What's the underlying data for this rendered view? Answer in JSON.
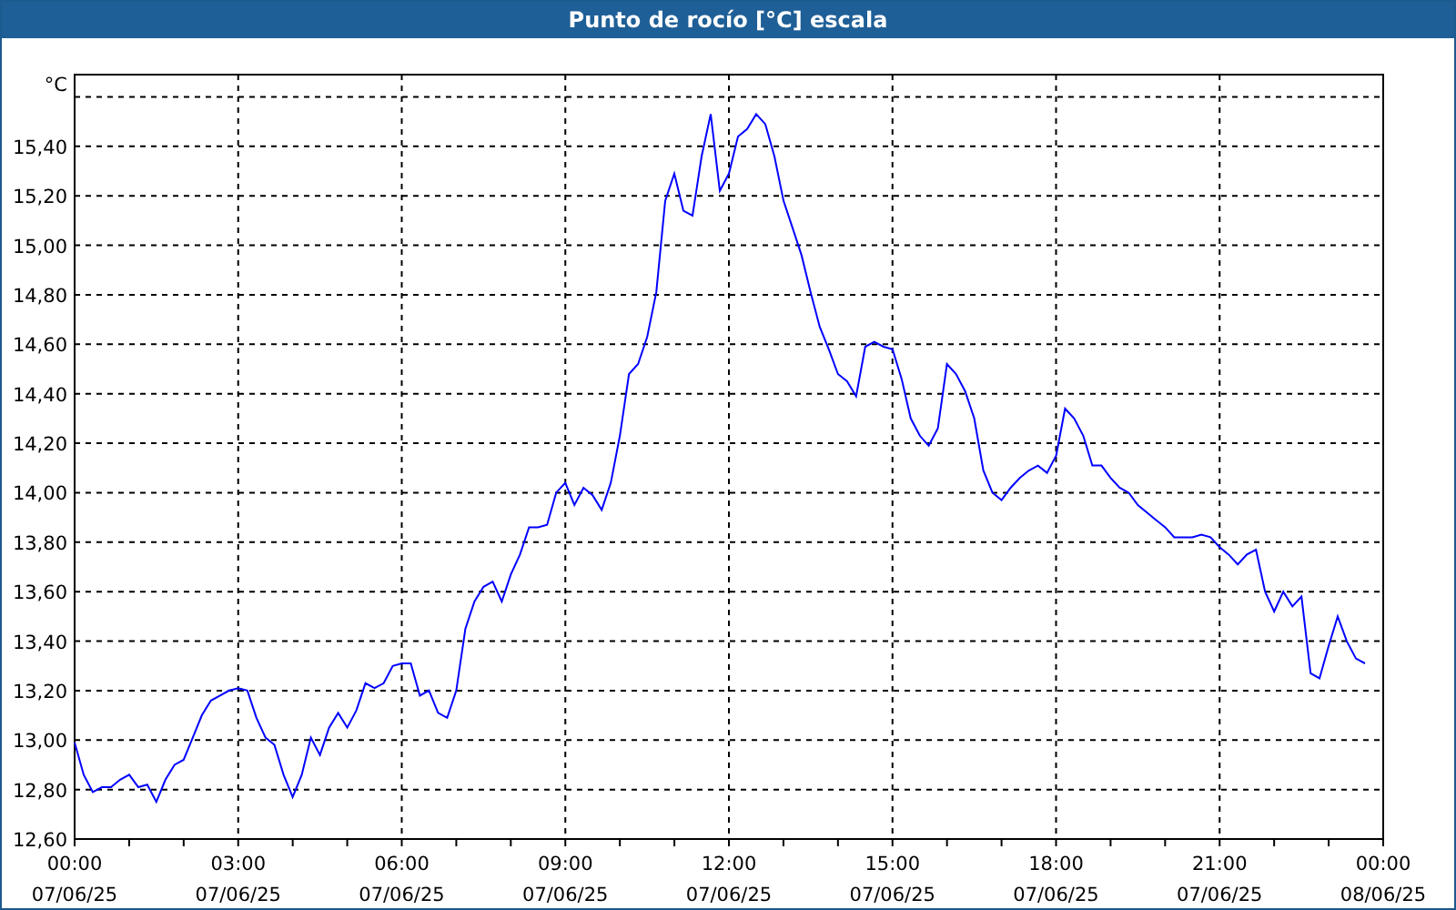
{
  "window": {
    "title": "Punto de rocío [°C] escala"
  },
  "chart": {
    "chart_data": {
      "type": "line",
      "grid": true,
      "ylabel": "°C",
      "ylim": [
        12.6,
        15.69
      ],
      "yticks": [
        {
          "value": 12.6,
          "label": "12,60"
        },
        {
          "value": 12.8,
          "label": "12,80"
        },
        {
          "value": 13.0,
          "label": "13,00"
        },
        {
          "value": 13.2,
          "label": "13,20"
        },
        {
          "value": 13.4,
          "label": "13,40"
        },
        {
          "value": 13.6,
          "label": "13,60"
        },
        {
          "value": 13.8,
          "label": "13,80"
        },
        {
          "value": 14.0,
          "label": "14,00"
        },
        {
          "value": 14.2,
          "label": "14,20"
        },
        {
          "value": 14.4,
          "label": "14,40"
        },
        {
          "value": 14.6,
          "label": "14,60"
        },
        {
          "value": 14.8,
          "label": "14,80"
        },
        {
          "value": 15.0,
          "label": "15,00"
        },
        {
          "value": 15.2,
          "label": "15,20"
        },
        {
          "value": 15.4,
          "label": "15,40"
        }
      ],
      "categories": [
        "00:00\n07/06/25",
        null,
        null,
        null,
        null,
        null,
        null,
        null,
        null,
        null,
        null,
        null,
        null,
        null,
        null,
        null,
        null,
        null,
        "03:00\n07/06/25",
        null,
        null,
        null,
        null,
        null,
        null,
        null,
        null,
        null,
        null,
        null,
        null,
        null,
        null,
        null,
        null,
        null,
        "06:00\n07/06/25",
        null,
        null,
        null,
        null,
        null,
        null,
        null,
        null,
        null,
        null,
        null,
        null,
        null,
        null,
        null,
        null,
        null,
        "09:00\n07/06/25",
        null,
        null,
        null,
        null,
        null,
        null,
        null,
        null,
        null,
        null,
        null,
        null,
        null,
        null,
        null,
        null,
        null,
        "12:00\n07/06/25",
        null,
        null,
        null,
        null,
        null,
        null,
        null,
        null,
        null,
        null,
        null,
        null,
        null,
        null,
        null,
        null,
        null,
        "15:00\n07/06/25",
        null,
        null,
        null,
        null,
        null,
        null,
        null,
        null,
        null,
        null,
        null,
        null,
        null,
        null,
        null,
        null,
        null,
        "18:00\n07/06/25",
        null,
        null,
        null,
        null,
        null,
        null,
        null,
        null,
        null,
        null,
        null,
        null,
        null,
        null,
        null,
        null,
        null,
        "21:00\n07/06/25",
        null,
        null,
        null,
        null,
        null,
        null,
        null,
        null,
        null,
        null,
        null,
        null,
        null,
        null,
        null,
        null,
        null,
        "00:00\n08/06/25"
      ],
      "series": [
        {
          "color": "#0000ff",
          "values": [
            12.99,
            12.86,
            12.79,
            12.81,
            12.81,
            12.84,
            12.86,
            12.81,
            12.82,
            12.75,
            12.84,
            12.9,
            12.92,
            13.01,
            13.1,
            13.16,
            13.18,
            13.2,
            13.21,
            13.2,
            13.09,
            13.01,
            12.98,
            12.86,
            12.77,
            12.86,
            13.01,
            12.94,
            13.05,
            13.11,
            13.05,
            13.12,
            13.23,
            13.21,
            13.23,
            13.3,
            13.31,
            13.31,
            13.18,
            13.2,
            13.11,
            13.09,
            13.2,
            13.45,
            13.56,
            13.62,
            13.64,
            13.56,
            13.67,
            13.75,
            13.86,
            13.86,
            13.87,
            14.0,
            14.04,
            13.95,
            14.02,
            13.99,
            13.93,
            14.04,
            14.23,
            14.48,
            14.52,
            14.63,
            14.81,
            15.18,
            15.29,
            15.14,
            15.12,
            15.36,
            15.53,
            15.22,
            15.29,
            15.44,
            15.47,
            15.53,
            15.49,
            15.36,
            15.18,
            15.07,
            14.96,
            14.81,
            14.67,
            14.58,
            14.48,
            14.45,
            14.39,
            14.59,
            14.61,
            14.59,
            14.58,
            14.46,
            14.3,
            14.23,
            14.19,
            14.26,
            14.52,
            14.48,
            14.41,
            14.3,
            14.09,
            14.0,
            13.97,
            14.02,
            14.06,
            14.09,
            14.11,
            14.08,
            14.15,
            14.34,
            14.3,
            14.23,
            14.11,
            14.11,
            14.06,
            14.02,
            14.0,
            13.95,
            13.92,
            13.89,
            13.86,
            13.82,
            13.82,
            13.82,
            13.83,
            13.82,
            13.78,
            13.75,
            13.71,
            13.75,
            13.77,
            13.6,
            13.52,
            13.6,
            13.54,
            13.58,
            13.27,
            13.25,
            13.38,
            13.5,
            13.4,
            13.33,
            13.31,
            null,
            null
          ]
        }
      ]
    }
  }
}
